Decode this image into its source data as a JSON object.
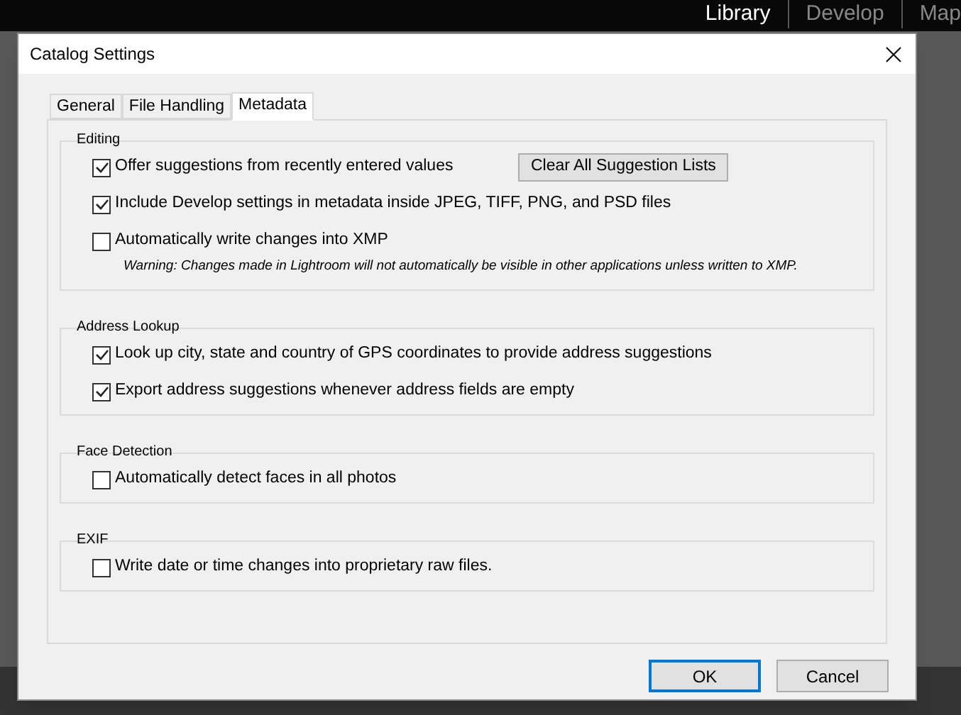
{
  "background_app": {
    "modules": [
      {
        "label": "Library",
        "selected": true
      },
      {
        "label": "Develop",
        "selected": false
      },
      {
        "label": "Map",
        "selected": false
      }
    ]
  },
  "dialog": {
    "title": "Catalog Settings",
    "tabs": [
      {
        "label": "General",
        "selected": false
      },
      {
        "label": "File Handling",
        "selected": false
      },
      {
        "label": "Metadata",
        "selected": true
      }
    ],
    "sections": [
      {
        "title": "Editing",
        "items": [
          {
            "kind": "checkbox",
            "label": "Offer suggestions from recently entered values",
            "checked": true,
            "button": "Clear All Suggestion Lists"
          },
          {
            "kind": "checkbox",
            "label": "Include Develop settings in metadata inside JPEG, TIFF, PNG, and PSD files",
            "checked": true
          },
          {
            "kind": "checkbox",
            "label": "Automatically write changes into XMP",
            "checked": false
          },
          {
            "kind": "note",
            "text": "Warning: Changes made in Lightroom will not automatically be visible in other applications unless written to XMP."
          }
        ]
      },
      {
        "title": "Address Lookup",
        "items": [
          {
            "kind": "checkbox",
            "label": "Look up city, state and country of GPS coordinates to provide address suggestions",
            "checked": true
          },
          {
            "kind": "checkbox",
            "label": "Export address suggestions whenever address fields are empty",
            "checked": true
          }
        ]
      },
      {
        "title": "Face Detection",
        "items": [
          {
            "kind": "checkbox",
            "label": "Automatically detect faces in all photos",
            "checked": false
          }
        ]
      },
      {
        "title": "EXIF",
        "items": [
          {
            "kind": "checkbox",
            "label": "Write date or time changes into proprietary raw files.",
            "checked": false
          }
        ]
      }
    ],
    "buttons": [
      {
        "label": "OK",
        "default": true
      },
      {
        "label": "Cancel",
        "default": false
      }
    ]
  }
}
